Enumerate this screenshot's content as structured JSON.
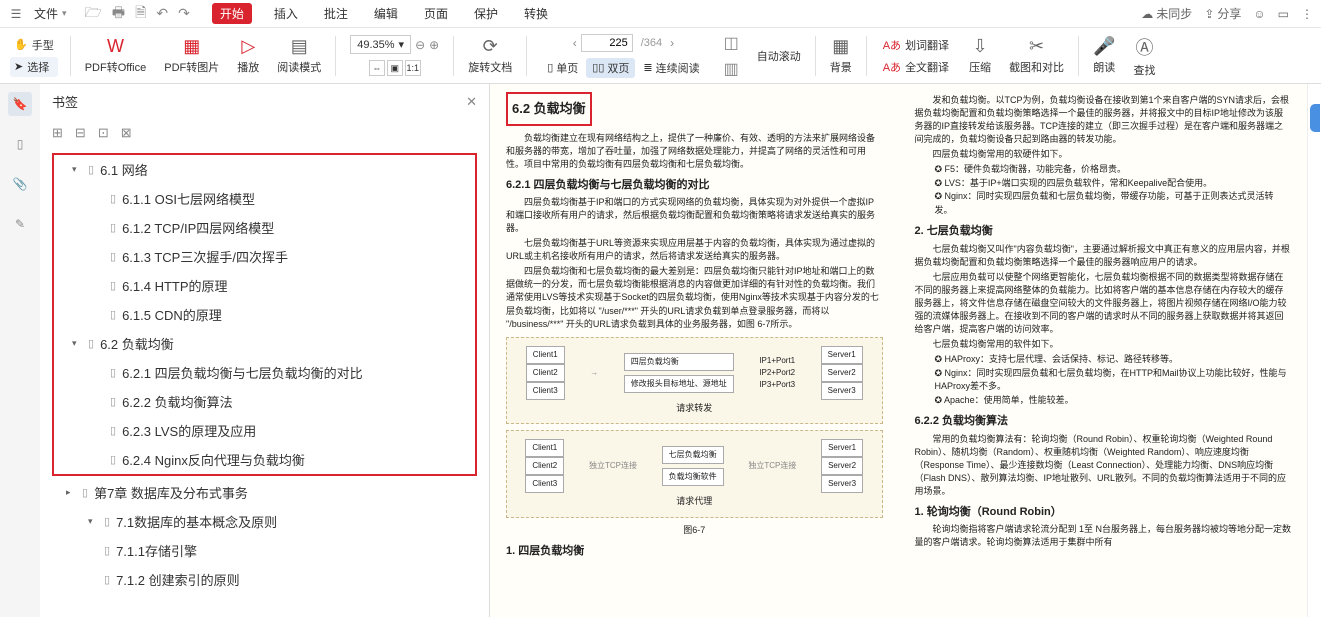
{
  "menubar": {
    "file": "文件",
    "tabs": [
      "开始",
      "插入",
      "批注",
      "编辑",
      "页面",
      "保护",
      "转换"
    ],
    "active_tab": 0,
    "right": {
      "sync": "未同步",
      "share": "分享"
    }
  },
  "toolbar": {
    "hand": "手型",
    "select": "选择",
    "pdf_office": "PDF转Office",
    "pdf_img": "PDF转图片",
    "play": "播放",
    "readmode": "阅读模式",
    "zoom": "49.35%",
    "rotate": "旋转文档",
    "page_current": "225",
    "page_total": "/364",
    "single": "单页",
    "double": "双页",
    "continuous": "连续阅读",
    "autoscroll": "自动滚动",
    "background": "背景",
    "dict": "划词翻译",
    "fulltrans": "全文翻译",
    "compress": "压缩",
    "screenshot": "截图和对比",
    "read_aloud": "朗读",
    "find": "查找"
  },
  "bookmarks": {
    "title": "书签",
    "items": [
      {
        "level": 0,
        "toggle": "▾",
        "text": "6.1 网络"
      },
      {
        "level": 1,
        "toggle": "",
        "text": "6.1.1 OSI七层网络模型"
      },
      {
        "level": 1,
        "toggle": "",
        "text": "6.1.2 TCP/IP四层网络模型"
      },
      {
        "level": 1,
        "toggle": "",
        "text": "6.1.3 TCP三次握手/四次挥手"
      },
      {
        "level": 1,
        "toggle": "",
        "text": "6.1.4 HTTP的原理"
      },
      {
        "level": 1,
        "toggle": "",
        "text": "6.1.5 CDN的原理"
      },
      {
        "level": 0,
        "toggle": "▾",
        "text": "6.2 负载均衡"
      },
      {
        "level": 1,
        "toggle": "",
        "text": "6.2.1 四层负载均衡与七层负载均衡的对比"
      },
      {
        "level": 1,
        "toggle": "",
        "text": "6.2.2 负载均衡算法"
      },
      {
        "level": 1,
        "toggle": "",
        "text": "6.2.3 LVS的原理及应用"
      },
      {
        "level": 1,
        "toggle": "",
        "text": "6.2.4 Nginx反向代理与负载均衡"
      }
    ],
    "after": [
      {
        "level": 0,
        "toggle": "▸",
        "text": "第7章 数据库及分布式事务"
      },
      {
        "level": 1,
        "toggle": "▾",
        "text": "7.1数据库的基本概念及原则"
      },
      {
        "level": 2,
        "toggle": "",
        "text": "7.1.1存储引擎"
      },
      {
        "level": 2,
        "toggle": "",
        "text": "7.1.2 创建索引的原则"
      }
    ]
  },
  "page_left": {
    "title": "6.2 负载均衡",
    "intro": "负载均衡建立在现有网络结构之上，提供了一种廉价、有效、透明的方法来扩展网络设备和服务器的带宽，增加了吞吐量，加强了网络数据处理能力，并提高了网络的灵活性和可用性。项目中常用的负载均衡有四层负载均衡和七层负载均衡。",
    "h621": "6.2.1 四层负载均衡与七层负载均衡的对比",
    "p1": "四层负载均衡基于IP和端口的方式实现网络的负载均衡，具体实现为对外提供一个虚拟IP和端口接收所有用户的请求，然后根据负载均衡配置和负载均衡策略将请求发送给真实的服务器。",
    "p2": "七层负载均衡基于URL等资源来实现应用层基于内容的负载均衡，具体实现为通过虚拟的URL或主机名接收所有用户的请求，然后将请求发送给真实的服务器。",
    "p3": "四层负载均衡和七层负载均衡的最大差别是：四层负载均衡只能针对IP地址和端口上的数据做统一的分发，而七层负载均衡能根据消息的内容做更加详细的有针对性的负载均衡。我们通常使用LVS等技术实现基于Socket的四层负载均衡，使用Nginx等技术实现基于内容分发的七层负载均衡，比如将以 \"/user/***\" 开头的URL请求负载到单点登录服务器，而将以 \"/business/***\" 开头的URL请求负载到具体的业务服务器，如图 6-7所示。",
    "diag1": {
      "clients": [
        "Client1",
        "Client2",
        "Client3"
      ],
      "center": "四层负载均衡",
      "note": "修改报头目标地址、源地址",
      "ports": [
        "IP1+Port1",
        "IP2+Port2",
        "IP3+Port3"
      ],
      "servers": [
        "Server1",
        "Server2",
        "Server3"
      ],
      "label": "请求转发"
    },
    "diag2": {
      "clients": [
        "Client1",
        "Client2",
        "Client3"
      ],
      "center1": "七层负载均衡",
      "center2": "负载均衡软件",
      "tcp": "独立TCP连接",
      "servers": [
        "Server1",
        "Server2",
        "Server3"
      ],
      "label": "请求代理"
    },
    "figcap": "图6-7",
    "h1": "1. 四层负载均衡"
  },
  "page_right": {
    "p0": "发和负载均衡。以TCP为例，负载均衡设备在接收到第1个来自客户端的SYN请求后，会根据负载均衡配置和负载均衡策略选择一个最佳的服务器，并将报文中的目标IP地址修改为该服务器的IP直接转发给该服务器。TCP连接的建立（即三次握手过程）是在客户端和服务器端之间完成的，负载均衡设备只起到路由器的转发功能。",
    "li1_t": "四层负载均衡常用的软硬件如下。",
    "li1a": "F5：硬件负载均衡器，功能完备，价格昂贵。",
    "li1b": "LVS：基于IP+端口实现的四层负载软件，常和Keepalive配合使用。",
    "li1c": "Nginx：同时实现四层负载和七层负载均衡，带缓存功能，可基于正则表达式灵活转发。",
    "h2": "2. 七层负载均衡",
    "p1": "七层负载均衡又叫作\"内容负载均衡\"，主要通过解析报文中真正有意义的应用层内容，并根据负载均衡配置和负载均衡策略选择一个最佳的服务器响应用户的请求。",
    "p2": "七层应用负载可以使整个网络更智能化，七层负载均衡根据不同的数据类型将数据存储在不同的服务器上来提高网络整体的负载能力。比如将客户端的基本信息存储在内存较大的缓存服务器上，将文件信息存储在磁盘空间较大的文件服务器上，将图片视频存储在网络I/O能力较强的流媒体服务器上。在接收到不同的客户端的请求时从不同的服务器上获取数据并将其返回给客户端，提高客户端的访问效率。",
    "li2_t": "七层负载均衡常用的软件如下。",
    "li2a": "HAProxy：支持七层代理、会话保持、标记、路径转移等。",
    "li2b": "Nginx：同时实现四层负载和七层负载均衡，在HTTP和Mail协议上功能比较好，性能与HAProxy差不多。",
    "li2c": "Apache：使用简单，性能较差。",
    "h622": "6.2.2 负载均衡算法",
    "p3": "常用的负载均衡算法有：轮询均衡（Round Robin）、权重轮询均衡（Weighted Round Robin）、随机均衡（Random）、权重随机均衡（Weighted Random）、响应速度均衡（Response Time）、最少连接数均衡（Least Connection）、处理能力均衡、DNS响应均衡（Flash DNS）、散列算法均衡、IP地址散列、URL散列。不同的负载均衡算法适用于不同的应用场景。",
    "h1rr": "1. 轮询均衡（Round Robin）",
    "p4": "轮询均衡指将客户端请求轮流分配到 1至 N台服务器上，每台服务器均被均等地分配一定数量的客户端请求。轮询均衡算法适用于集群中所有"
  }
}
